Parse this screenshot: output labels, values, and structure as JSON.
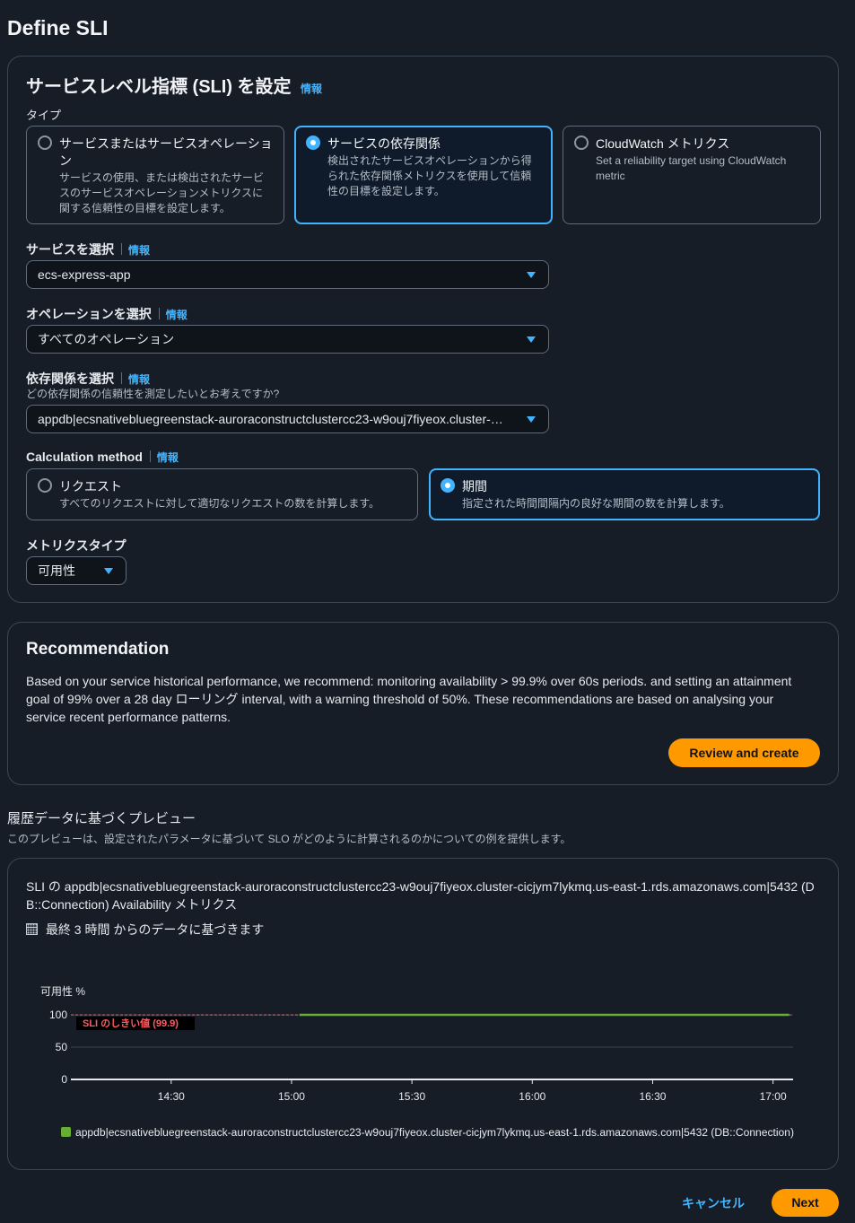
{
  "page": {
    "title": "Define SLI"
  },
  "sli": {
    "heading": "サービスレベル指標 (SLI) を設定",
    "info": "情報",
    "type_label": "タイプ",
    "types": [
      {
        "title": "サービスまたはサービスオペレーション",
        "desc": "サービスの使用、または検出されたサービスのサービスオペレーションメトリクスに関する信頼性の目標を設定します。",
        "selected": false
      },
      {
        "title": "サービスの依存関係",
        "desc": "検出されたサービスオペレーションから得られた依存関係メトリクスを使用して信頼性の目標を設定します。",
        "selected": true
      },
      {
        "title": "CloudWatch メトリクス",
        "desc": "Set a reliability target using CloudWatch metric",
        "selected": false
      }
    ],
    "service_label": "サービスを選択",
    "service_value": "ecs-express-app",
    "operation_label": "オペレーションを選択",
    "operation_value": "すべてのオペレーション",
    "dependency_label": "依存関係を選択",
    "dependency_sublabel": "どの依存関係の信頼性を測定したいとお考えですか?",
    "dependency_value": "appdb|ecsnativebluegreenstack-auroraconstructclustercc23-w9ouj7fiyeox.cluster-…",
    "calc_label": "Calculation method",
    "calc_methods": [
      {
        "title": "リクエスト",
        "desc": "すべてのリクエストに対して適切なリクエストの数を計算します。",
        "selected": false
      },
      {
        "title": "期間",
        "desc": "指定された時間間隔内の良好な期間の数を計算します。",
        "selected": true
      }
    ],
    "metric_type_label": "メトリクスタイプ",
    "metric_type_value": "可用性"
  },
  "recommendation": {
    "heading": "Recommendation",
    "text": "Based on your service historical performance, we recommend: monitoring availability > 99.9% over 60s periods. and setting an attainment goal of 99% over a 28 day ローリング interval, with a warning threshold of 50%. These recommendations are based on analysing your service recent performance patterns.",
    "button": "Review and create"
  },
  "preview": {
    "heading": "履歴データに基づくプレビュー",
    "sub": "このプレビューは、設定されたパラメータに基づいて SLO がどのように計算されるのかについての例を提供します。",
    "metric_title": "SLI の appdb|ecsnativebluegreenstack-auroraconstructclustercc23-w9ouj7fiyeox.cluster-cicjym7lykmq.us-east-1.rds.amazonaws.com|5432 (DB::Connection) Availability メトリクス",
    "range_text": "最終 3 時間 からのデータに基づきます"
  },
  "chart_data": {
    "type": "line",
    "ylabel": "可用性 %",
    "yticks": [
      "100",
      "50",
      "0"
    ],
    "ylim": [
      0,
      100
    ],
    "xticks": [
      "14:30",
      "15:00",
      "15:30",
      "16:00",
      "16:30",
      "17:00"
    ],
    "threshold": {
      "label": "SLI のしきい値 (99.9)",
      "value": 99.9
    },
    "series": [
      {
        "name": "appdb|ecsnativebluegreenstack-auroraconstructclustercc23-w9ouj7fiyeox.cluster-cicjym7lykmq.us-east-1.rds.amazonaws.com|5432 (DB::Connection)",
        "color": "#69ae34",
        "x": [
          "15:02",
          "17:04"
        ],
        "values": [
          100,
          100
        ]
      }
    ],
    "legend": "bottom"
  },
  "footer": {
    "cancel": "キャンセル",
    "next": "Next"
  },
  "colors": {
    "accent": "#42b4ff",
    "primary": "#ff9900",
    "threshold": "#ff5d64",
    "series": "#69ae34"
  }
}
